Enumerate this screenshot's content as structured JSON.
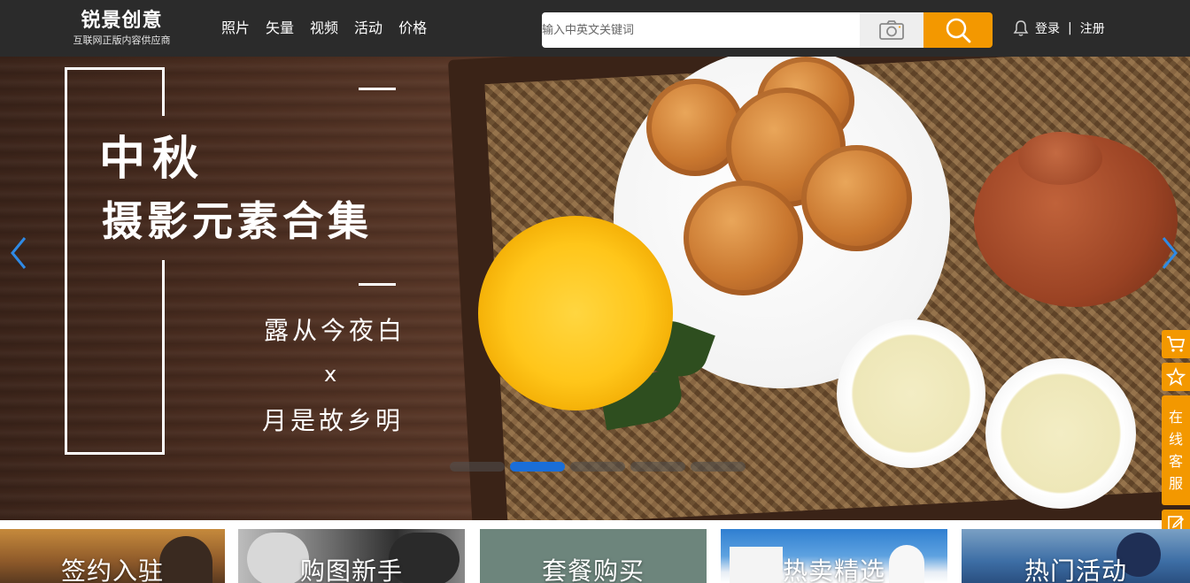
{
  "header": {
    "logo_title": "锐景创意",
    "logo_subtitle": "互联网正版内容供应商",
    "nav": [
      "照片",
      "矢量",
      "视频",
      "活动",
      "价格"
    ],
    "search_placeholder": "输入中英文关键词",
    "login": "登录",
    "separator": "|",
    "register": "注册",
    "icons": [
      "camera-icon",
      "search-icon",
      "bell-icon"
    ],
    "accent_color": "#f39800",
    "background_color": "#2b2b2b"
  },
  "banner": {
    "title_line1": "中秋",
    "title_line2": "摄影元素合集",
    "poem_line1": "露从今夜白",
    "poem_x": "x",
    "poem_line2": "月是故乡明",
    "slide_count": 5,
    "active_slide": 2,
    "active_dot_color": "#1a6ed8",
    "icons": [
      "chevron-left-icon",
      "chevron-right-icon"
    ]
  },
  "sidebar": {
    "customer_service": [
      "在",
      "线",
      "客",
      "服"
    ],
    "icons": [
      "cart-icon",
      "star-icon",
      "edit-icon"
    ]
  },
  "categories": [
    {
      "label": "签约入驻"
    },
    {
      "label": "购图新手"
    },
    {
      "label": "套餐购买"
    },
    {
      "label": "热卖精选"
    },
    {
      "label": "热门活动"
    }
  ]
}
